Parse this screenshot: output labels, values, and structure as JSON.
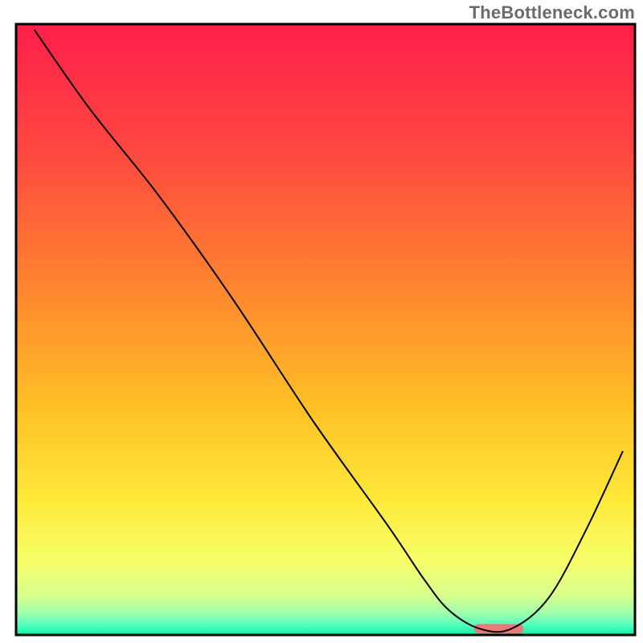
{
  "watermark": {
    "text": "TheBottleneck.com"
  },
  "chart_data": {
    "type": "line",
    "title": "",
    "xlabel": "",
    "ylabel": "",
    "xlim": [
      0,
      100
    ],
    "ylim": [
      0,
      100
    ],
    "series": [
      {
        "name": "curve",
        "x": [
          3,
          12,
          23,
          35,
          48,
          60,
          66,
          70,
          75,
          80,
          86,
          92,
          98
        ],
        "y": [
          99,
          86,
          72,
          55,
          35,
          18,
          9,
          4,
          1,
          1,
          6,
          17,
          30
        ]
      }
    ],
    "marker": {
      "name": "sweet-spot",
      "x_start": 74,
      "x_end": 82,
      "y": 1,
      "color": "#e77a7a"
    },
    "gradient_stops": [
      {
        "offset": 0.0,
        "color": "#ff1f4b"
      },
      {
        "offset": 0.22,
        "color": "#ff4a3f"
      },
      {
        "offset": 0.45,
        "color": "#ff8b2e"
      },
      {
        "offset": 0.63,
        "color": "#ffc126"
      },
      {
        "offset": 0.78,
        "color": "#ffe93a"
      },
      {
        "offset": 0.88,
        "color": "#f7ff6a"
      },
      {
        "offset": 0.935,
        "color": "#d8ff8c"
      },
      {
        "offset": 0.965,
        "color": "#9dffac"
      },
      {
        "offset": 0.985,
        "color": "#4dffbf"
      },
      {
        "offset": 1.0,
        "color": "#08f5a0"
      }
    ],
    "frame_color": "#000000",
    "frame_width": 3,
    "curve_color": "#000000",
    "curve_width": 2
  }
}
